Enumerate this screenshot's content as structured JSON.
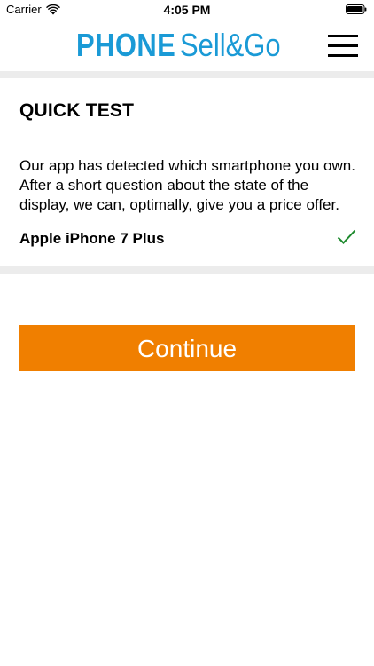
{
  "status_bar": {
    "carrier": "Carrier",
    "time": "4:05 PM",
    "wifi_icon": "wifi-icon",
    "battery_icon": "battery-icon"
  },
  "header": {
    "logo_phone": "PHONE",
    "logo_sellgo": "Sell&Go",
    "brand_color": "#1a9ad6",
    "menu_icon": "hamburger-menu-icon"
  },
  "card": {
    "title": "QUICK TEST",
    "description": "Our app has detected which smartphone you own. After a short question about the state of the display, we can, optimally, give you a price offer.",
    "device_name": "Apple iPhone 7 Plus",
    "device_status_icon": "check-icon",
    "check_color": "#1e8a2e"
  },
  "actions": {
    "continue_label": "Continue",
    "accent_color": "#f07f00"
  }
}
